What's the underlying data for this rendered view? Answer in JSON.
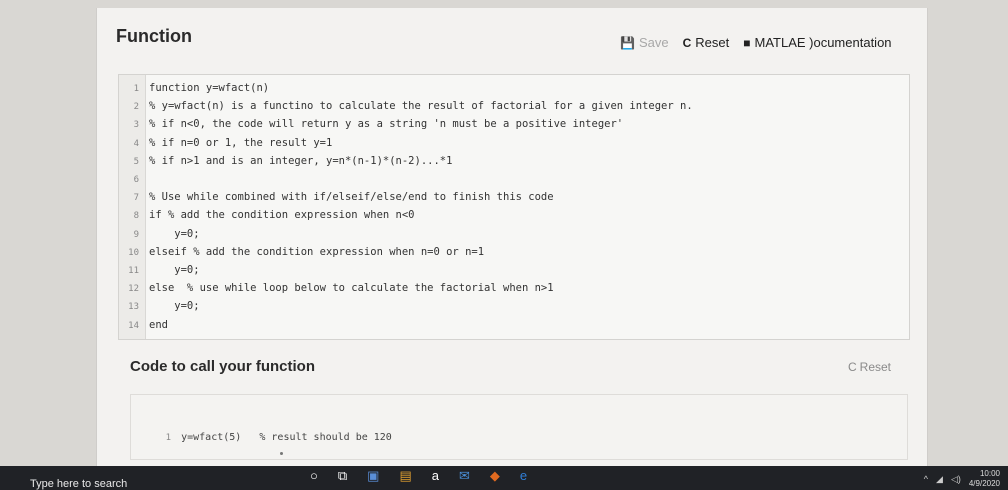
{
  "header": {
    "title": "Function",
    "save_label": "Save",
    "reset_label": "Reset",
    "docs_label": "MATLAE )ocumentation"
  },
  "editor": {
    "lines": [
      {
        "n": "1",
        "code": "function y=wfact(n)"
      },
      {
        "n": "2",
        "code": "% y=wfact(n) is a functino to calculate the result of factorial for a given integer n."
      },
      {
        "n": "3",
        "code": "% if n<0, the code will return y as a string 'n must be a positive integer'"
      },
      {
        "n": "4",
        "code": "% if n=0 or 1, the result y=1"
      },
      {
        "n": "5",
        "code": "% if n>1 and is an integer, y=n*(n-1)*(n-2)...*1"
      },
      {
        "n": "6",
        "code": ""
      },
      {
        "n": "7",
        "code": "% Use while combined with if/elseif/else/end to finish this code"
      },
      {
        "n": "8",
        "code": "if % add the condition expression when n<0"
      },
      {
        "n": "9",
        "code": "    y=0;"
      },
      {
        "n": "10",
        "code": "elseif % add the condition expression when n=0 or n=1"
      },
      {
        "n": "11",
        "code": "    y=0;"
      },
      {
        "n": "12",
        "code": "else  % use while loop below to calculate the factorial when n>1"
      },
      {
        "n": "13",
        "code": "    y=0;"
      },
      {
        "n": "14",
        "code": "end"
      }
    ]
  },
  "call_section": {
    "title": "Code to call your function",
    "reset_label": "Reset",
    "line_no": "1",
    "code": "y=wfact(5)   % result should be 120"
  },
  "taskbar": {
    "search_text": "Type here to search",
    "time": "10:00",
    "date": "4/9/2020"
  }
}
